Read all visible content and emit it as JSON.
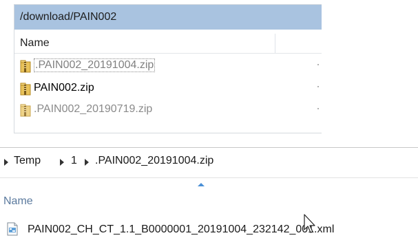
{
  "top_window": {
    "path": "/download/PAIN002",
    "column_name": "Name",
    "files": [
      {
        "name": ".PAIN002_20191004.zip",
        "state": "selected-faded"
      },
      {
        "name": "PAIN002.zip",
        "state": "normal"
      },
      {
        "name": ".PAIN002_20190719.zip",
        "state": "faded"
      }
    ]
  },
  "bottom_window": {
    "breadcrumb": [
      "Temp",
      "1",
      ".PAIN002_20191004.zip"
    ],
    "column_name": "Name",
    "files": [
      {
        "name": "PAIN002_CH_CT_1.1_B0000001_20191004_232142_001.xml"
      }
    ]
  },
  "colors": {
    "path_bar": "#a9c3e0",
    "sort_arrow": "#4a8fd6",
    "name_header": "#5b7a9e"
  }
}
